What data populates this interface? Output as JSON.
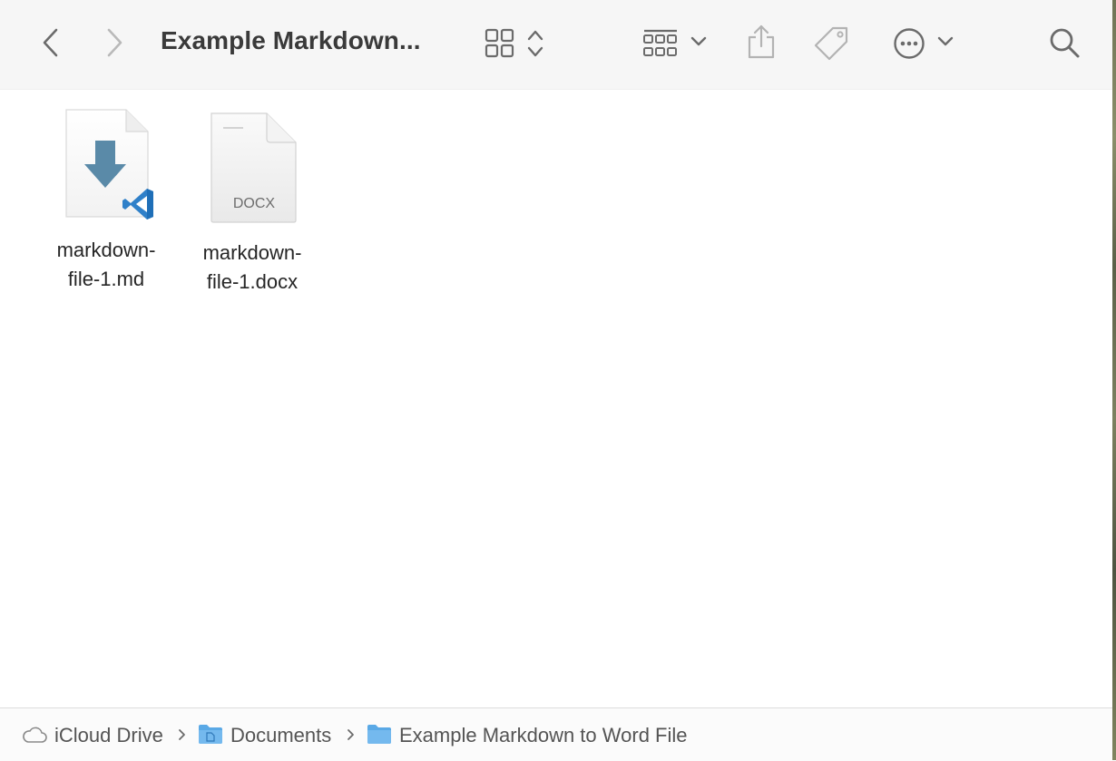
{
  "window": {
    "title": "Example Markdown..."
  },
  "toolbar": {
    "back_icon": "chevron-left-icon",
    "forward_icon": "chevron-right-icon",
    "view_icon": "grid-view-icon",
    "group_icon": "group-by-icon",
    "share_icon": "share-icon",
    "tag_icon": "tag-icon",
    "more_icon": "ellipsis-circle-icon",
    "search_icon": "search-icon"
  },
  "files": [
    {
      "name_line1": "markdown-",
      "name_line2": "file-1.md",
      "icon": "vscode-markdown-file-icon"
    },
    {
      "name_line1": "markdown-",
      "name_line2": "file-1.docx",
      "icon": "docx-document-icon",
      "badge": "DOCX"
    }
  ],
  "pathbar": {
    "items": [
      {
        "label": "iCloud Drive",
        "icon": "icloud-icon"
      },
      {
        "label": "Documents",
        "icon": "documents-folder-icon"
      },
      {
        "label": "Example Markdown to Word File",
        "icon": "folder-icon"
      }
    ]
  },
  "colors": {
    "toolbar_bg": "#f6f6f6",
    "icon_gray": "#6b6b6b",
    "vscode_blue": "#2f80c9",
    "markdown_arrow": "#5488a8",
    "folder_blue": "#5aa9e6"
  }
}
